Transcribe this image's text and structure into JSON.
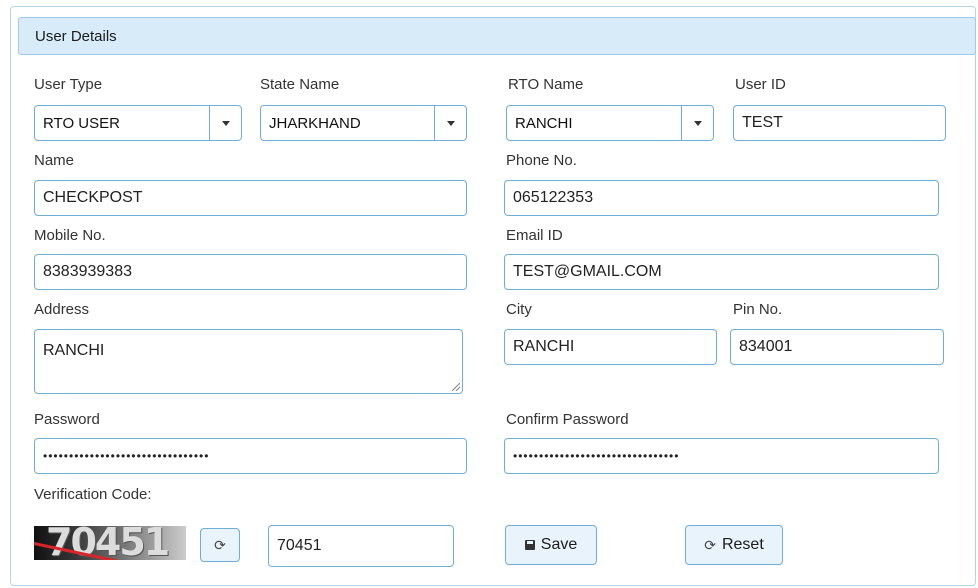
{
  "panel": {
    "title": "User Details"
  },
  "labels": {
    "user_type": "User Type",
    "state_name": "State Name",
    "rto_name": "RTO Name",
    "user_id": "User ID",
    "name": "Name",
    "phone": "Phone No.",
    "mobile": "Mobile No.",
    "email": "Email ID",
    "address": "Address",
    "city": "City",
    "pin": "Pin No.",
    "password": "Password",
    "confirm_password": "Confirm Password",
    "verification_code": "Verification Code:"
  },
  "values": {
    "user_type": "RTO USER",
    "state_name": "JHARKHAND",
    "rto_name": "RANCHI",
    "user_id": "TEST",
    "name": "CHECKPOST",
    "phone": "065122353",
    "mobile": "8383939383",
    "email": "TEST@GMAIL.COM",
    "address": "RANCHI",
    "city": "RANCHI",
    "pin": "834001",
    "password": "••••••••••••••••••••••••••••••••",
    "confirm_password": "••••••••••••••••••••••••••••••••",
    "verification_input": "70451"
  },
  "captcha": {
    "code": "70451"
  },
  "buttons": {
    "save": "Save",
    "reset": "Reset",
    "refresh_icon": "refresh-icon",
    "save_icon": "floppy-disk-icon"
  },
  "colors": {
    "header_bg": "#d7ebf9",
    "border": "#6faed9",
    "button_bg": "#e8f3fb"
  }
}
